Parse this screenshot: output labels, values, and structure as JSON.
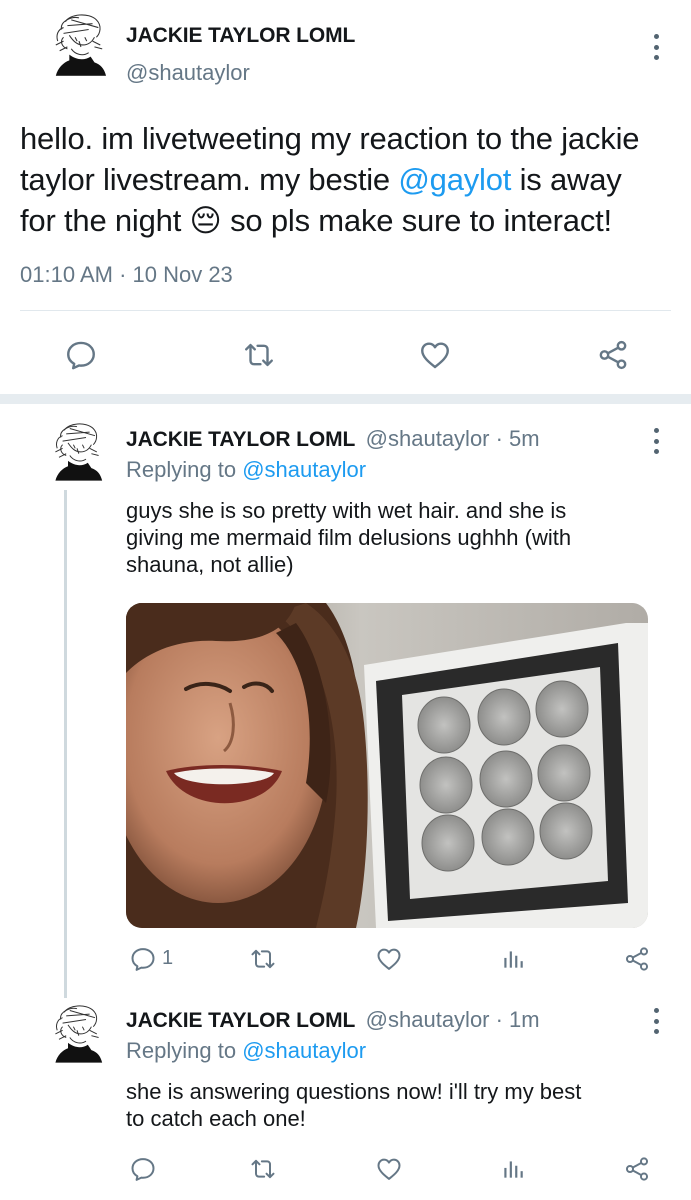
{
  "main_tweet": {
    "author_name": "JACKIE TAYLOR LOML",
    "author_handle": "@shautaylor",
    "text_line1": "hello. im livetweeting my reaction to the jackie",
    "text_line2": "taylor livestream. my bestie",
    "mention": "@gaylot",
    "text_line2_end": " is away",
    "text_line3_start": "for the night ",
    "emoji": "😔",
    "text_line3_end": " so pls make sure to interact!",
    "timestamp": "01:10 AM · 10 Nov 23",
    "actions": [
      "reply-icon",
      "retweet-icon",
      "like-icon",
      "share-icon"
    ]
  },
  "reply1": {
    "author_name": "JACKIE TAYLOR LOML",
    "author_handle": "@shautaylor · 5m",
    "replying_prefix": "Replying to ",
    "replying_handle": "@shautaylor",
    "text_lines": [
      "guys she is so pretty with wet hair. and she is",
      "giving me mermaid film delusions ughhh (with",
      "shauna, not allie)"
    ],
    "reply_count": "1",
    "actions": [
      "reply-icon",
      "retweet-icon",
      "like-icon",
      "analytics-icon",
      "share-icon"
    ]
  },
  "reply2": {
    "author_name": "JACKIE TAYLOR LOML",
    "author_handle": "@shautaylor · 1m",
    "replying_prefix": "Replying to ",
    "replying_handle": "@shautaylor",
    "text_lines": [
      "she is answering questions now! i'll try my best",
      "to catch each one!"
    ],
    "actions": [
      "reply-icon",
      "retweet-icon",
      "like-icon",
      "analytics-icon",
      "share-icon"
    ]
  },
  "colors": {
    "accent": "#1d9bf0",
    "secondary_text": "#657786",
    "divider": "#e1e8ed"
  }
}
